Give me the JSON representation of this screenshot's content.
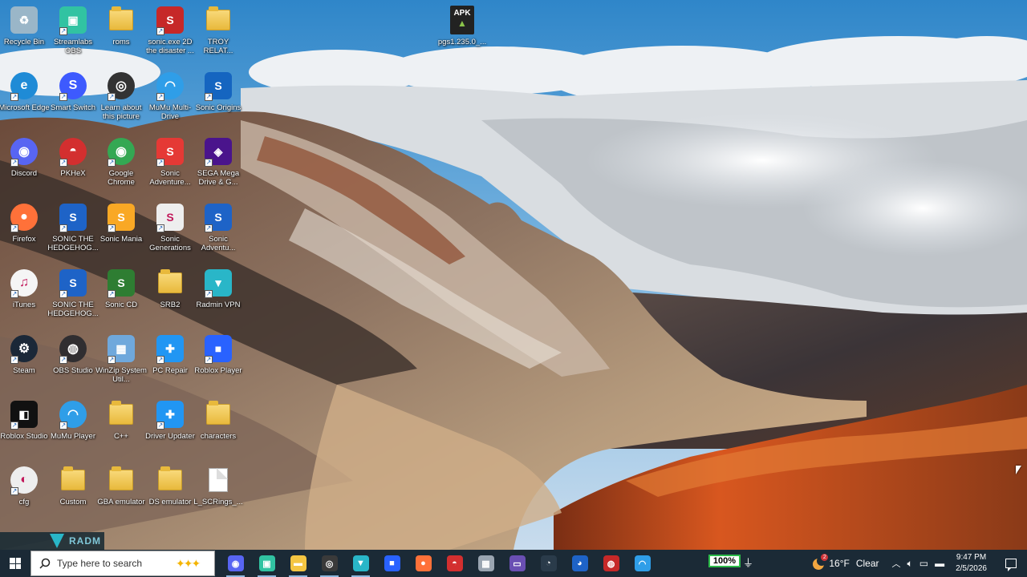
{
  "desktop": {
    "icons": [
      {
        "label": "Recycle Bin",
        "icon": "recycle-bin-icon",
        "color": "#9ab6c8"
      },
      {
        "label": "Streamlabs OBS",
        "icon": "streamlabs-icon",
        "color": "#31c3a2"
      },
      {
        "label": "roms",
        "icon": "folder-icon"
      },
      {
        "label": "sonic.exe 2D the disaster ...",
        "icon": "sonic-exe-icon",
        "color": "#c62828"
      },
      {
        "label": "TROY RELAT...",
        "icon": "folder-icon"
      },
      {
        "label": "Microsoft Edge",
        "icon": "edge-icon",
        "color": "#1f8bd6"
      },
      {
        "label": "Smart Switch",
        "icon": "smart-switch-icon",
        "color": "#3d5afe"
      },
      {
        "label": "Learn about this picture",
        "icon": "learn-picture-icon",
        "color": "#333333"
      },
      {
        "label": "MuMu Multi-Drive",
        "icon": "mumu-multidrive-icon",
        "color": "#2f9ee8"
      },
      {
        "label": "Sonic Origins",
        "icon": "sonic-origins-icon",
        "color": "#1565c0"
      },
      {
        "label": "Discord",
        "icon": "discord-icon",
        "color": "#5865f2"
      },
      {
        "label": "PKHeX",
        "icon": "pokeball-icon",
        "color": "#d32f2f"
      },
      {
        "label": "Google Chrome",
        "icon": "chrome-icon",
        "color": "#34a853"
      },
      {
        "label": "Sonic Adventure...",
        "icon": "sonic-adventure-icon",
        "color": "#e53935"
      },
      {
        "label": "SEGA Mega Drive & G...",
        "icon": "sega-megadrive-icon",
        "color": "#4a148c"
      },
      {
        "label": "Firefox",
        "icon": "firefox-icon",
        "color": "#ff7139"
      },
      {
        "label": "SONIC THE HEDGEHOG...",
        "icon": "sonic-icon",
        "color": "#1e63c7"
      },
      {
        "label": "Sonic Mania",
        "icon": "sonic-mania-icon",
        "color": "#f9a825"
      },
      {
        "label": "Sonic Generations",
        "icon": "sonic-generations-icon",
        "color": "#eeeeee"
      },
      {
        "label": "Sonic Adventu...",
        "icon": "sonic-adventure2-icon",
        "color": "#1e63c7"
      },
      {
        "label": "iTunes",
        "icon": "itunes-icon",
        "color": "#f5f5f5"
      },
      {
        "label": "SONIC THE HEDGEHOG...",
        "icon": "sonic-icon",
        "color": "#1e63c7"
      },
      {
        "label": "Sonic CD",
        "icon": "sonic-cd-icon",
        "color": "#2e7d32"
      },
      {
        "label": "SRB2",
        "icon": "folder-icon"
      },
      {
        "label": "Radmin VPN",
        "icon": "radmin-icon",
        "color": "#29b6c8"
      },
      {
        "label": "Steam",
        "icon": "steam-icon",
        "color": "#1b2838"
      },
      {
        "label": "OBS Studio",
        "icon": "obs-icon",
        "color": "#302e31"
      },
      {
        "label": "WinZip System Util...",
        "icon": "winzip-icon",
        "color": "#6fa8dc"
      },
      {
        "label": "PC Repair",
        "icon": "pc-repair-icon",
        "color": "#2196f3"
      },
      {
        "label": "Roblox Player",
        "icon": "roblox-icon",
        "color": "#2962ff"
      },
      {
        "label": "Roblox Studio",
        "icon": "roblox-studio-icon",
        "color": "#111111"
      },
      {
        "label": "MuMu Player",
        "icon": "mumu-icon",
        "color": "#2f9ee8"
      },
      {
        "label": "C++",
        "icon": "folder-icon"
      },
      {
        "label": "Driver Updater",
        "icon": "driver-updater-icon",
        "color": "#2196f3"
      },
      {
        "label": "characters",
        "icon": "folder-icon"
      },
      {
        "label": "cfg",
        "icon": "cfg-icon",
        "color": "#eeeeee"
      },
      {
        "label": "Custom",
        "icon": "folder-icon"
      },
      {
        "label": "GBA emulator",
        "icon": "folder-icon"
      },
      {
        "label": "DS emulator",
        "icon": "folder-icon"
      },
      {
        "label": "L_SCRings_...",
        "icon": "file-icon"
      }
    ],
    "extra_icon": {
      "label": "pgs1.235.0_...",
      "badge": "APK",
      "icon": "apk-icon"
    },
    "radmin_strip": "RADM"
  },
  "taskbar": {
    "search_placeholder": "Type here to search",
    "apps": [
      {
        "name": "discord-taskbar-icon",
        "color": "#5865f2",
        "glyph": "◉"
      },
      {
        "name": "streamlabs-taskbar-icon",
        "color": "#31c3a2",
        "glyph": "▣"
      },
      {
        "name": "file-explorer-taskbar-icon",
        "color": "#f4c542",
        "glyph": "▬"
      },
      {
        "name": "learn-picture-taskbar-icon",
        "color": "#3a3a3a",
        "glyph": "◎"
      },
      {
        "name": "radmin-taskbar-icon",
        "color": "#29b6c8",
        "glyph": "▼"
      },
      {
        "name": "roblox-taskbar-icon",
        "color": "#2962ff",
        "glyph": "■"
      },
      {
        "name": "firefox-taskbar-icon",
        "color": "#ff7139",
        "glyph": "●"
      },
      {
        "name": "pokeball-taskbar-icon",
        "color": "#d32f2f",
        "glyph": "◓"
      },
      {
        "name": "winzip-taskbar-icon",
        "color": "#9aa5b1",
        "glyph": "▦"
      },
      {
        "name": "emulator-taskbar-icon",
        "color": "#6a4fb3",
        "glyph": "▭"
      },
      {
        "name": "speedometer-taskbar-icon",
        "color": "#2a3b4a",
        "glyph": "◔"
      },
      {
        "name": "sonic-taskbar-icon",
        "color": "#1e63c7",
        "glyph": "◕"
      },
      {
        "name": "game-taskbar-icon",
        "color": "#c62828",
        "glyph": "◍"
      },
      {
        "name": "mumu-taskbar-icon",
        "color": "#2f9ee8",
        "glyph": "◠"
      }
    ],
    "battery": "100%",
    "weather": {
      "temp": "16°F",
      "condition": "Clear",
      "badge": "2"
    },
    "clock": {
      "time": "9:47 PM",
      "date": "2/5/2026"
    }
  }
}
